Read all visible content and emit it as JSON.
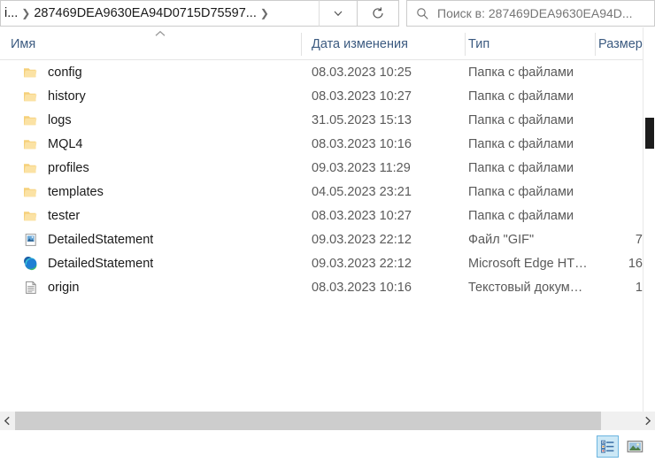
{
  "window": {
    "address": {
      "crumb_first": "i...",
      "crumb_current": "287469DEA9630EA94D0715D75597...",
      "dropdown_icon": "chevron-down-icon",
      "refresh_icon": "refresh-icon"
    },
    "search": {
      "icon": "search-icon",
      "placeholder": "Поиск в: 287469DEA9630EA94D..."
    }
  },
  "columns": {
    "name": "Имя",
    "date_modified": "Дата изменения",
    "type": "Тип",
    "size": "Размер",
    "sort_indicator": "chevron-up-icon"
  },
  "files": [
    {
      "name": "config",
      "icon": "folder-icon",
      "date": "08.03.2023 10:25",
      "type": "Папка с файлами",
      "size": ""
    },
    {
      "name": "history",
      "icon": "folder-icon",
      "date": "08.03.2023 10:27",
      "type": "Папка с файлами",
      "size": ""
    },
    {
      "name": "logs",
      "icon": "folder-icon",
      "date": "31.05.2023 15:13",
      "type": "Папка с файлами",
      "size": ""
    },
    {
      "name": "MQL4",
      "icon": "folder-icon",
      "date": "08.03.2023 10:16",
      "type": "Папка с файлами",
      "size": ""
    },
    {
      "name": "profiles",
      "icon": "folder-icon",
      "date": "09.03.2023 11:29",
      "type": "Папка с файлами",
      "size": ""
    },
    {
      "name": "templates",
      "icon": "folder-icon",
      "date": "04.05.2023 23:21",
      "type": "Папка с файлами",
      "size": ""
    },
    {
      "name": "tester",
      "icon": "folder-icon",
      "date": "08.03.2023 10:27",
      "type": "Папка с файлами",
      "size": ""
    },
    {
      "name": "DetailedStatement",
      "icon": "gif-file-icon",
      "date": "09.03.2023 22:12",
      "type": "Файл \"GIF\"",
      "size": "7"
    },
    {
      "name": "DetailedStatement",
      "icon": "edge-icon",
      "date": "09.03.2023 22:12",
      "type": "Microsoft Edge HT…",
      "size": "16"
    },
    {
      "name": "origin",
      "icon": "text-file-icon",
      "date": "08.03.2023 10:16",
      "type": "Текстовый докум…",
      "size": "1"
    }
  ],
  "scrollbars": {
    "horizontal_left_icon": "chevron-left-icon",
    "horizontal_right_icon": "chevron-right-icon"
  },
  "view_buttons": [
    {
      "name": "details-view",
      "selected": true
    },
    {
      "name": "thumbnail-view",
      "selected": false
    }
  ],
  "colors": {
    "folder": "#f7d486",
    "header_text": "#3b5a80",
    "selection": "#cce8f6"
  }
}
